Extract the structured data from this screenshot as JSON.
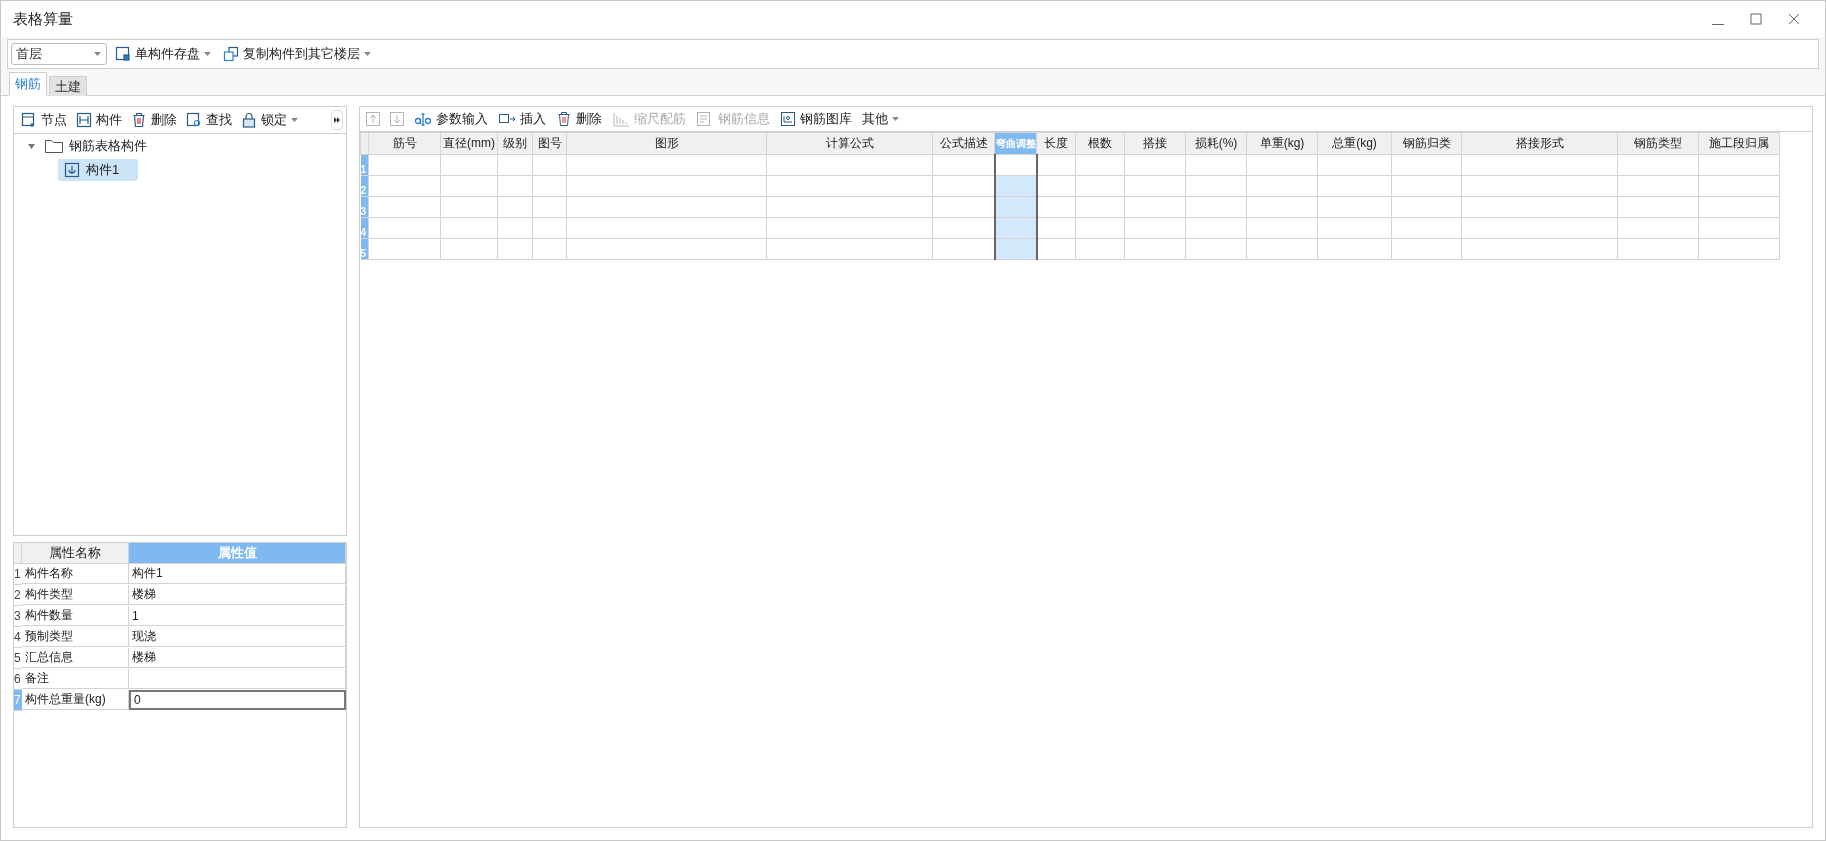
{
  "window": {
    "title": "表格算量"
  },
  "toolbar": {
    "floor": {
      "value": "首层"
    },
    "buttons": [
      {
        "label": "单构件存盘",
        "dropdown": true
      },
      {
        "label": "复制构件到其它楼层",
        "dropdown": true
      }
    ]
  },
  "tabs": [
    {
      "label": "钢筋",
      "selected": true
    },
    {
      "label": "土建",
      "selected": false
    }
  ],
  "left_toolbar": [
    {
      "label": "节点",
      "dropdown": false
    },
    {
      "label": "构件",
      "dropdown": false
    },
    {
      "label": "删除",
      "dropdown": false
    },
    {
      "label": "查找",
      "dropdown": false
    },
    {
      "label": "锁定",
      "dropdown": true
    }
  ],
  "tree": [
    {
      "label": "钢筋表格构件",
      "expanded": true,
      "children": [
        {
          "label": "构件1",
          "selected": true
        }
      ]
    }
  ],
  "properties": {
    "columns": [
      {
        "label": "属性名称",
        "selected": false
      },
      {
        "label": "属性值",
        "selected": true
      }
    ],
    "rows": [
      {
        "num": "1",
        "name": "构件名称",
        "value": "构件1",
        "selected": false
      },
      {
        "num": "2",
        "name": "构件类型",
        "value": "楼梯",
        "selected": false
      },
      {
        "num": "3",
        "name": "构件数量",
        "value": "1",
        "selected": false
      },
      {
        "num": "4",
        "name": "预制类型",
        "value": "现浇",
        "selected": false
      },
      {
        "num": "5",
        "name": "汇总信息",
        "value": "楼梯",
        "selected": false
      },
      {
        "num": "6",
        "name": "备注",
        "selected": false
      },
      {
        "num": "7",
        "name": "构件总重量(kg)",
        "value": "0",
        "selected": true
      }
    ]
  },
  "grid_toolbar": [
    {
      "kind": "up",
      "disabled": true
    },
    {
      "kind": "down",
      "disabled": true
    },
    {
      "kind": "params",
      "label": "参数输入",
      "disabled": false
    },
    {
      "kind": "insert",
      "label": "插入",
      "disabled": false
    },
    {
      "kind": "delete",
      "label": "删除",
      "disabled": false
    },
    {
      "kind": "scale",
      "label": "缩尺配筋",
      "disabled": true
    },
    {
      "kind": "info",
      "label": "钢筋信息",
      "disabled": true
    },
    {
      "kind": "library",
      "label": "钢筋图库",
      "disabled": false
    },
    {
      "kind": "menu",
      "label": "其他",
      "disabled": false
    }
  ],
  "grid": {
    "columns": [
      {
        "label": "筋号",
        "selected": false
      },
      {
        "label": "直径(mm)",
        "selected": false
      },
      {
        "label": "级别",
        "selected": false
      },
      {
        "label": "图号",
        "selected": false
      },
      {
        "label": "图形",
        "selected": false
      },
      {
        "label": "计算公式",
        "selected": false
      },
      {
        "label": "公式描述",
        "selected": false
      },
      {
        "label": "弯曲调整",
        "selected": true
      },
      {
        "label": "长度",
        "selected": false
      },
      {
        "label": "根数",
        "selected": false
      },
      {
        "label": "搭接",
        "selected": false
      },
      {
        "label": "损耗(%)",
        "selected": false
      },
      {
        "label": "单重(kg)",
        "selected": false
      },
      {
        "label": "总重(kg)",
        "selected": false
      },
      {
        "label": "钢筋归类",
        "selected": false
      },
      {
        "label": "搭接形式",
        "selected": false
      },
      {
        "label": "钢筋类型",
        "selected": false
      },
      {
        "label": "施工段归属",
        "selected": false
      }
    ],
    "rows": [
      {
        "num": "1",
        "current": true
      },
      {
        "num": "2",
        "current": false
      },
      {
        "num": "3",
        "current": false
      },
      {
        "num": "4",
        "current": false
      },
      {
        "num": "5",
        "current": false
      }
    ]
  }
}
